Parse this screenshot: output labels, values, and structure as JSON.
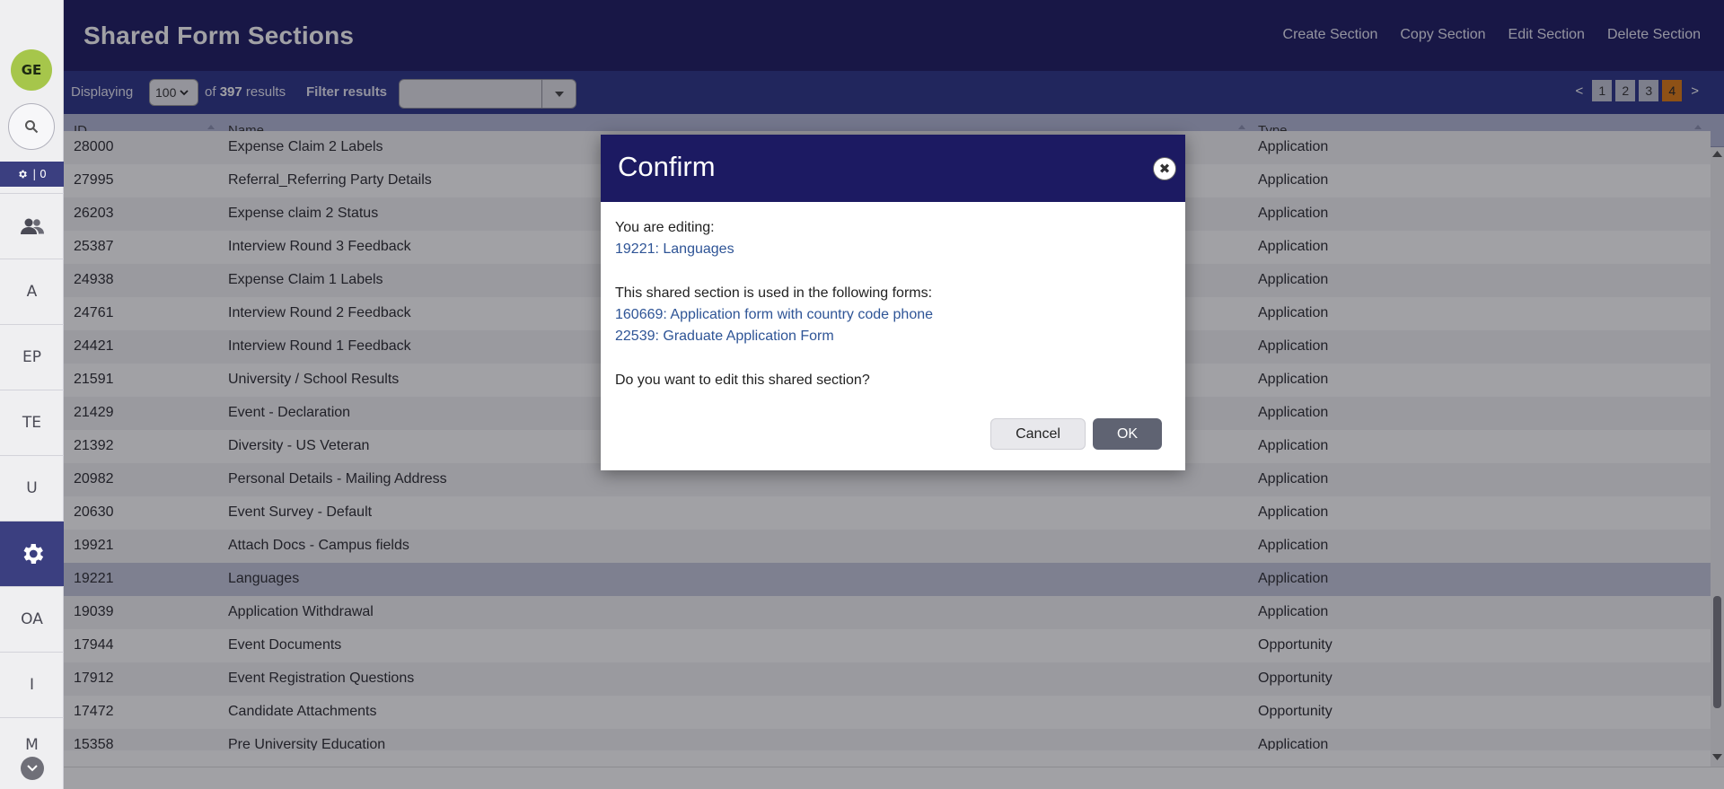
{
  "rail": {
    "avatar_initials": "GE",
    "badge_count": "| 0",
    "items": [
      "A",
      "EP",
      "TE",
      "U",
      "OA",
      "I",
      "M"
    ]
  },
  "header": {
    "title": "Shared Form Sections",
    "actions": [
      "Create Section",
      "Copy Section",
      "Edit Section",
      "Delete Section"
    ]
  },
  "toolbar": {
    "displaying_label": "Displaying",
    "page_size": "100",
    "of_label": "of",
    "total": "397",
    "results_label": "results",
    "filter_label": "Filter results",
    "filter_value": "",
    "pages": [
      "1",
      "2",
      "3",
      "4"
    ],
    "current_page": "4",
    "prev": "<",
    "next": ">"
  },
  "table": {
    "columns": [
      "ID",
      "Name",
      "Type"
    ],
    "rows": [
      {
        "id": "28000",
        "name": "Expense Claim 2 Labels",
        "type": "Application"
      },
      {
        "id": "27995",
        "name": "Referral_Referring Party Details",
        "type": "Application"
      },
      {
        "id": "26203",
        "name": "Expense claim 2 Status",
        "type": "Application"
      },
      {
        "id": "25387",
        "name": "Interview Round 3 Feedback",
        "type": "Application"
      },
      {
        "id": "24938",
        "name": "Expense Claim 1 Labels",
        "type": "Application"
      },
      {
        "id": "24761",
        "name": "Interview Round 2 Feedback",
        "type": "Application"
      },
      {
        "id": "24421",
        "name": "Interview Round 1 Feedback",
        "type": "Application"
      },
      {
        "id": "21591",
        "name": "University / School Results",
        "type": "Application"
      },
      {
        "id": "21429",
        "name": "Event - Declaration",
        "type": "Application"
      },
      {
        "id": "21392",
        "name": "Diversity - US Veteran",
        "type": "Application"
      },
      {
        "id": "20982",
        "name": "Personal Details - Mailing Address",
        "type": "Application"
      },
      {
        "id": "20630",
        "name": "Event Survey - Default",
        "type": "Application"
      },
      {
        "id": "19921",
        "name": "Attach Docs - Campus fields",
        "type": "Application"
      },
      {
        "id": "19221",
        "name": "Languages",
        "type": "Application",
        "selected": true
      },
      {
        "id": "19039",
        "name": "Application Withdrawal",
        "type": "Application"
      },
      {
        "id": "17944",
        "name": "Event Documents",
        "type": "Opportunity"
      },
      {
        "id": "17912",
        "name": "Event Registration Questions",
        "type": "Opportunity"
      },
      {
        "id": "17472",
        "name": "Candidate Attachments",
        "type": "Opportunity"
      },
      {
        "id": "15358",
        "name": "Pre University Education",
        "type": "Application"
      }
    ]
  },
  "modal": {
    "title": "Confirm",
    "editing_label": "You are editing:",
    "editing_link": "19221: Languages",
    "used_in_label": "This shared section is used in the following forms:",
    "forms": [
      "160669: Application form with country code phone",
      "22539: Graduate Application Form"
    ],
    "question": "Do you want to edit this shared section?",
    "cancel_label": "Cancel",
    "ok_label": "OK",
    "close_glyph": "✖"
  }
}
